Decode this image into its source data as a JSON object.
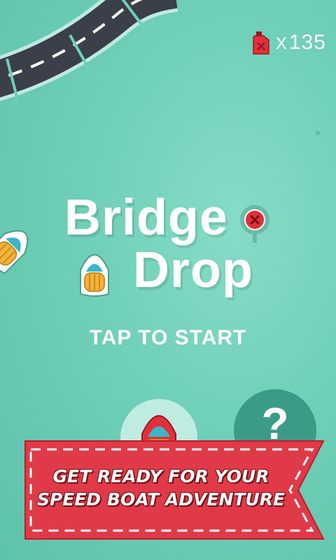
{
  "game": {
    "title_line1": "Bridge",
    "title_line2": "Drop",
    "start_prompt": "TAP TO START",
    "help_label": "?"
  },
  "fuel": {
    "multiplier": "X",
    "count": "135",
    "icon": "fuel-can-icon"
  },
  "banner": {
    "line1": "GET READY FOR YOUR",
    "line2": "SPEED BOAT ADVENTURE"
  },
  "colors": {
    "water": "#6fcfb7",
    "road": "#3a3f4a",
    "banner_red": "#e03a48",
    "boat_red": "#e0303c",
    "boat_yellow": "#f4b33a",
    "help_button": "#3c9b87"
  }
}
